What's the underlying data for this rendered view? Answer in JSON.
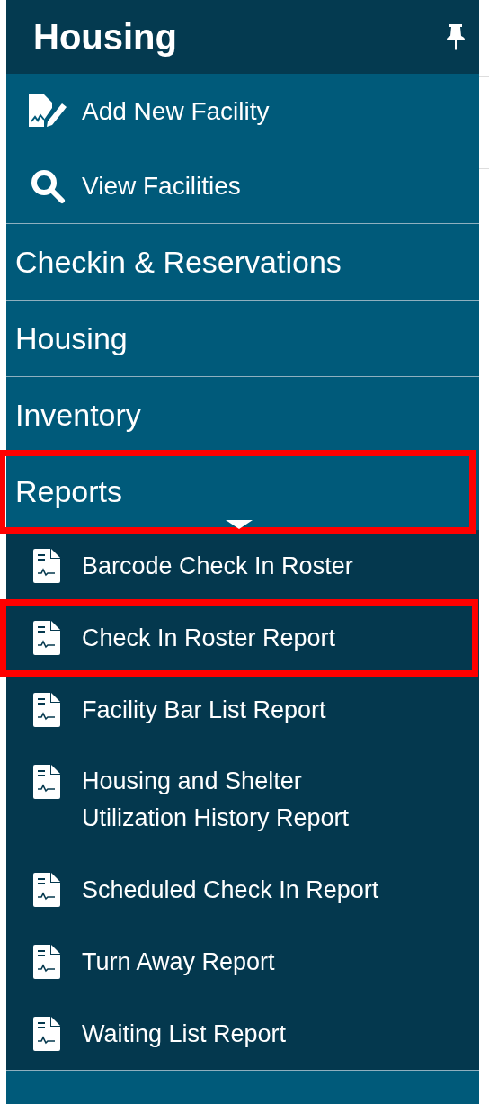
{
  "header": {
    "title": "Housing"
  },
  "actions": [
    {
      "kind": "add",
      "label": "Add New Facility"
    },
    {
      "kind": "view",
      "label": "View Facilities"
    }
  ],
  "sections": [
    {
      "label": "Checkin & Reservations",
      "expanded": false,
      "highlighted": false
    },
    {
      "label": "Housing",
      "expanded": false,
      "highlighted": false
    },
    {
      "label": "Inventory",
      "expanded": false,
      "highlighted": false
    },
    {
      "label": "Reports",
      "expanded": true,
      "highlighted": true,
      "children": [
        {
          "label": "Barcode Check In Roster",
          "highlighted": false
        },
        {
          "label": "Check In Roster Report",
          "highlighted": true
        },
        {
          "label": "Facility Bar List Report",
          "highlighted": false
        },
        {
          "label": "Housing and Shelter Utilization History Report",
          "highlighted": false
        },
        {
          "label": "Scheduled Check In Report",
          "highlighted": false
        },
        {
          "label": "Turn Away Report",
          "highlighted": false
        },
        {
          "label": "Waiting List Report",
          "highlighted": false
        }
      ]
    }
  ]
}
